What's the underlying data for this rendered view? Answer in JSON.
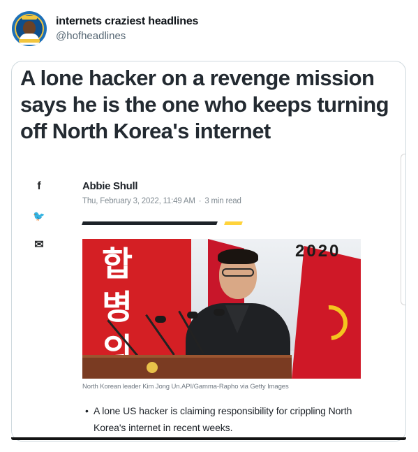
{
  "tweet": {
    "display_name": "internets craziest headlines",
    "handle": "@hofheadlines"
  },
  "card": {
    "headline": "A lone hacker on a revenge mission says he is the one who keeps turning off North Korea's internet"
  },
  "article": {
    "share_icons": [
      "facebook-icon",
      "twitter-icon",
      "mail-icon"
    ],
    "share_glyphs": [
      "f",
      "🐦",
      "✉"
    ],
    "author": "Abbie Shull",
    "date": "Thu, February 3, 2022, 11:49 AM",
    "read_time": "3 min read",
    "meta_separator": "·",
    "photo": {
      "korean_text": "합병의",
      "year_text": "2020"
    },
    "caption": "North Korean leader Kim Jong Un.API/Gamma-Rapho via Getty Images",
    "bullet": "A lone US hacker is claiming responsibility for crippling North Korea's internet in recent weeks.",
    "bullet_marker": "•"
  },
  "colors": {
    "accent_yellow": "#ffd33b",
    "text_dark": "#1d2228",
    "handle_gray": "#536471",
    "card_border": "#cfd9de"
  }
}
